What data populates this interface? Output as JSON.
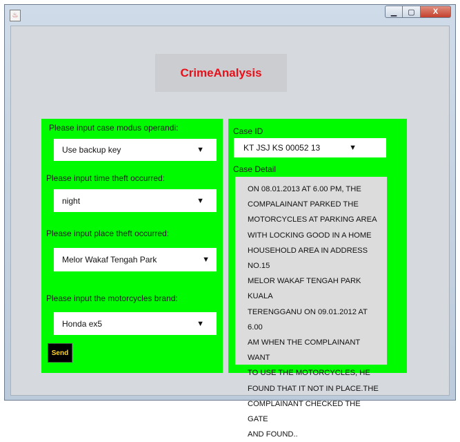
{
  "window": {
    "app_icon": "java-cup-icon",
    "buttons": {
      "minimize": "minimize-icon",
      "maximize": "maximize-icon",
      "close_label": "X"
    }
  },
  "header": {
    "title": "CrimeAnalysis"
  },
  "form": {
    "modus_label": "Please input case modus operandi:",
    "modus_value": "Use backup key",
    "time_label": "Please input time theft occurred:",
    "time_value": "night",
    "place_label": "Please input place theft occurred:",
    "place_value": "Melor Wakaf Tengah Park",
    "brand_label": "Please input the motorcycles brand:",
    "brand_value": "Honda ex5",
    "send_label": "Send",
    "dropdown_arrow": "▼"
  },
  "case": {
    "id_label": "Case ID",
    "id_value": "KT  JSJ  KS  00052  13",
    "detail_label": "Case Detail",
    "detail_lines": [
      "ON 08.01.2013 AT 6.00 PM, THE",
      "COMPALAINANT PARKED THE",
      "MOTORCYCLES AT PARKING AREA",
      "WITH LOCKING GOOD IN A HOME",
      "HOUSEHOLD AREA IN ADDRESS NO.15",
      "MELOR WAKAF TENGAH PARK KUALA",
      "TERENGGANU ON 09.01.2012 AT 6.00",
      "AM WHEN THE COMPLAINANT WANT",
      "TO USE THE MOTORCYCLES, HE",
      "FOUND THAT IT NOT IN PLACE.THE",
      "COMPLAINANT CHECKED THE GATE",
      "AND FOUND.."
    ]
  }
}
